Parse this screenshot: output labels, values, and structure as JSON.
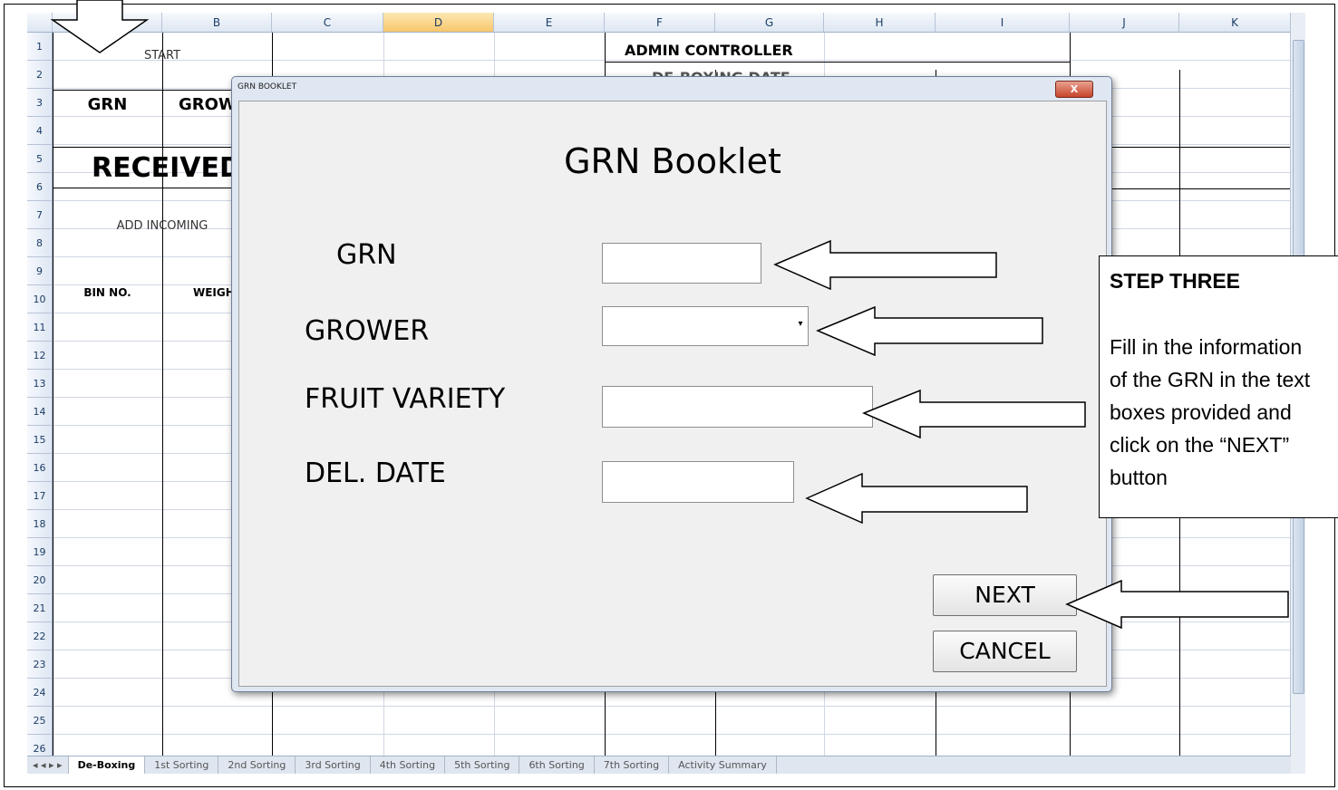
{
  "spreadsheet": {
    "columns": [
      "",
      "B",
      "C",
      "D",
      "E",
      "F",
      "G",
      "H",
      "I",
      "J",
      "K"
    ],
    "selected_column": "D",
    "rows": [
      "1",
      "2",
      "3",
      "4",
      "5",
      "6",
      "7",
      "8",
      "9",
      "10",
      "11",
      "12",
      "13",
      "14",
      "15",
      "16",
      "17",
      "18",
      "19",
      "20",
      "21",
      "22",
      "23",
      "24",
      "25",
      "26"
    ],
    "cells": {
      "start": "START",
      "grn": "GRN",
      "grower": "GROW",
      "received": "RECEIVED",
      "add_incoming": "ADD INCOMING",
      "bin_no": "BIN NO.",
      "weight": "WEIGH",
      "admin_controller": "ADMIN CONTROLLER",
      "deboxing_date": "DE-BOXING DATE"
    },
    "sheet_tabs": [
      "De-Boxing",
      "1st Sorting",
      "2nd Sorting",
      "3rd Sorting",
      "4th Sorting",
      "5th Sorting",
      "6th Sorting",
      "7th Sorting",
      "Activity Summary"
    ],
    "active_tab": "De-Boxing"
  },
  "dialog": {
    "window_title": "GRN BOOKLET",
    "close_label": "X",
    "heading": "GRN Booklet",
    "fields": {
      "grn_label": "GRN",
      "grower_label": "GROWER",
      "fruit_variety_label": "FRUIT VARIETY",
      "del_date_label": "DEL. DATE"
    },
    "buttons": {
      "next": "NEXT",
      "cancel": "CANCEL"
    }
  },
  "callout": {
    "title": "STEP THREE",
    "lines": [
      "Fill in the information",
      "of the GRN in the text",
      "boxes provided and",
      "click on the “NEXT”",
      "button"
    ]
  }
}
